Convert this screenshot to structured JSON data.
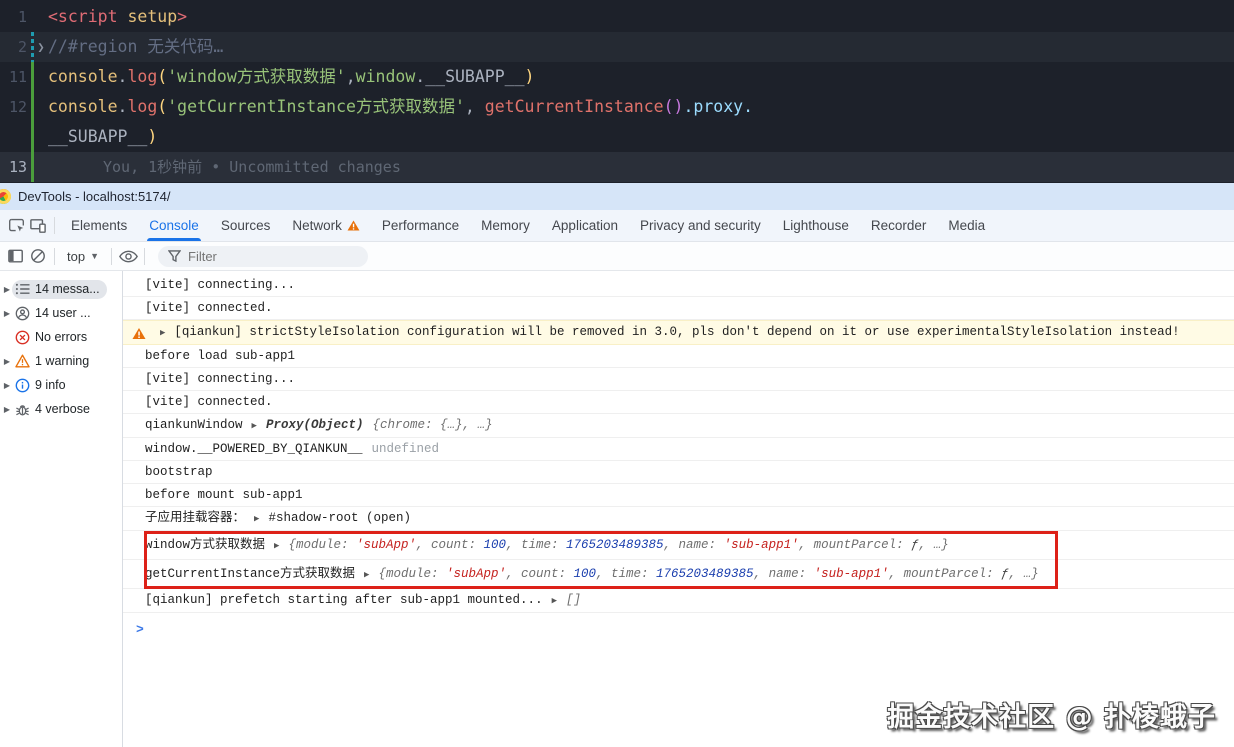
{
  "editor": {
    "lines": [
      {
        "num": "1",
        "bar": "",
        "tokens": [
          [
            "t-red",
            "<script"
          ],
          [
            "t-yel",
            " setup"
          ],
          [
            "t-red",
            ">"
          ]
        ]
      },
      {
        "num": "2",
        "bar": "mod",
        "fold": true,
        "hl": "hl2",
        "tokens": [
          [
            "t-com",
            "//#region 无关代码…"
          ]
        ]
      },
      {
        "num": "11",
        "bar": "add",
        "tokens": [
          [
            "t-yel",
            "console"
          ],
          [
            "t-fg",
            "."
          ],
          [
            "t-sal",
            "log"
          ],
          [
            "t-bry",
            "("
          ],
          [
            "t-grn",
            "'window方式获取数据'"
          ],
          [
            "t-fg",
            ","
          ],
          [
            "t-grn",
            "window"
          ],
          [
            "t-fg",
            ".__SUBAPP__"
          ],
          [
            "t-bry",
            ")"
          ]
        ]
      },
      {
        "num": "12",
        "bar": "add",
        "tokens": [
          [
            "t-yel",
            "console"
          ],
          [
            "t-fg",
            "."
          ],
          [
            "t-sal",
            "log"
          ],
          [
            "t-bry",
            "("
          ],
          [
            "t-grn",
            "'getCurrentInstance方式获取数据'"
          ],
          [
            "t-fg",
            ", "
          ],
          [
            "t-sal",
            "getCurrentInstance"
          ],
          [
            "t-brm",
            "()"
          ],
          [
            "t-blu",
            ".proxy."
          ]
        ]
      },
      {
        "num": "",
        "bar": "add",
        "tokens": [
          [
            "t-fg",
            "__SUBAPP__"
          ],
          [
            "t-bry",
            ")"
          ]
        ]
      },
      {
        "num": "13",
        "bar": "add",
        "hl": "hl",
        "blame": "You, 1秒钟前 • Uncommitted changes",
        "tokens": []
      }
    ]
  },
  "devtools": {
    "title": "DevTools - localhost:5174/",
    "tabs": [
      {
        "label": "Elements"
      },
      {
        "label": "Console",
        "active": true
      },
      {
        "label": "Sources"
      },
      {
        "label": "Network",
        "warning": true
      },
      {
        "label": "Performance"
      },
      {
        "label": "Memory"
      },
      {
        "label": "Application"
      },
      {
        "label": "Privacy and security"
      },
      {
        "label": "Lighthouse"
      },
      {
        "label": "Recorder"
      },
      {
        "label": "Media"
      }
    ],
    "toolbar": {
      "context_label": "top",
      "filter_placeholder": "Filter"
    },
    "sidebar": [
      {
        "key": "all-messages",
        "label": "14 messa...",
        "icon": "list",
        "expandable": true,
        "selected": true
      },
      {
        "key": "user-messages",
        "label": "14 user ...",
        "icon": "user",
        "expandable": true
      },
      {
        "key": "errors",
        "label": "No errors",
        "icon": "error",
        "expandable": false
      },
      {
        "key": "warnings",
        "label": "1 warning",
        "icon": "warning",
        "expandable": true
      },
      {
        "key": "info",
        "label": "9 info",
        "icon": "info",
        "expandable": true
      },
      {
        "key": "verbose",
        "label": "4 verbose",
        "icon": "bug",
        "expandable": true
      }
    ],
    "messages": [
      {
        "parts": [
          [
            "t",
            "[vite] connecting..."
          ]
        ]
      },
      {
        "parts": [
          [
            "t",
            "[vite] connected."
          ]
        ]
      },
      {
        "kind": "warn",
        "parts": [
          [
            "arr",
            ""
          ],
          [
            "t",
            "[qiankun] strictStyleIsolation configuration will be removed in 3.0, pls don't depend on it or use experimentalStyleIsolation instead!"
          ]
        ]
      },
      {
        "parts": [
          [
            "t",
            "before load sub-app1"
          ]
        ]
      },
      {
        "parts": [
          [
            "t",
            "[vite] connecting..."
          ]
        ]
      },
      {
        "parts": [
          [
            "t",
            "[vite] connected."
          ]
        ]
      },
      {
        "parts": [
          [
            "t",
            "qiankunWindow"
          ],
          [
            "arr",
            ""
          ],
          [
            "pb",
            "Proxy(Object)"
          ],
          [
            "p",
            "{chrome: {…}, …}"
          ]
        ]
      },
      {
        "parts": [
          [
            "t",
            "window.__POWERED_BY_QIANKUN__"
          ],
          [
            "mut",
            "undefined"
          ]
        ]
      },
      {
        "parts": [
          [
            "t",
            "bootstrap"
          ]
        ]
      },
      {
        "parts": [
          [
            "t",
            "before mount sub-app1"
          ]
        ]
      },
      {
        "parts": [
          [
            "t",
            "子应用挂载容器："
          ],
          [
            "arr",
            ""
          ],
          [
            "t",
            "#shadow-root (open)"
          ]
        ]
      },
      {
        "boxed": true,
        "parts": [
          [
            "t",
            "window方式获取数据"
          ],
          [
            "arr",
            ""
          ],
          [
            "p",
            "{module: "
          ],
          [
            "ps",
            "'subApp'"
          ],
          [
            "p",
            ", count: "
          ],
          [
            "pn",
            "100"
          ],
          [
            "p",
            ", time: "
          ],
          [
            "pn",
            "1765203489385"
          ],
          [
            "p",
            ", name: "
          ],
          [
            "ps",
            "'sub-app1'"
          ],
          [
            "p",
            ", mountParcel: "
          ],
          [
            "pf",
            "ƒ"
          ],
          [
            "p",
            ", …}"
          ]
        ]
      },
      {
        "boxed": true,
        "parts": [
          [
            "t",
            "getCurrentInstance方式获取数据"
          ],
          [
            "arr",
            ""
          ],
          [
            "p",
            "{module: "
          ],
          [
            "ps",
            "'subApp'"
          ],
          [
            "p",
            ", count: "
          ],
          [
            "pn",
            "100"
          ],
          [
            "p",
            ", time: "
          ],
          [
            "pn",
            "1765203489385"
          ],
          [
            "p",
            ", name: "
          ],
          [
            "ps",
            "'sub-app1'"
          ],
          [
            "p",
            ", mountParcel: "
          ],
          [
            "pf",
            "ƒ"
          ],
          [
            "p",
            ", …}"
          ]
        ]
      },
      {
        "parts": [
          [
            "t",
            "[qiankun] prefetch starting after sub-app1 mounted..."
          ],
          [
            "arr",
            ""
          ],
          [
            "p",
            "[]"
          ]
        ]
      },
      {
        "kind": "prompt",
        "parts": []
      }
    ]
  },
  "watermark": "掘金技术社区 @ 扑棱蛾子"
}
